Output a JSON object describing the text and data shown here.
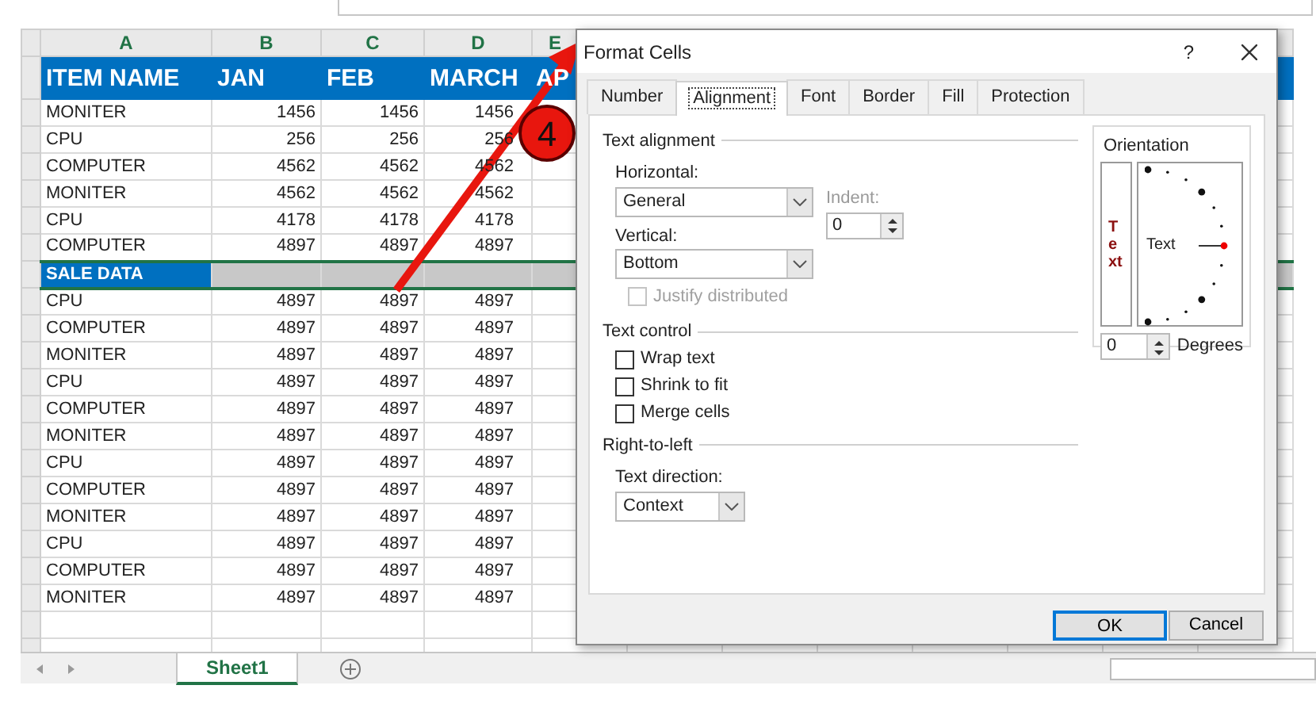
{
  "spreadsheet": {
    "column_letters": [
      "A",
      "B",
      "C",
      "D",
      "E"
    ],
    "header_row": [
      "ITEM NAME",
      "JAN",
      "FEB",
      "MARCH",
      "AP"
    ],
    "rows": [
      {
        "cells": [
          "MONITER",
          "1456",
          "1456",
          "1456"
        ],
        "selected": false
      },
      {
        "cells": [
          "CPU",
          "256",
          "256",
          "256"
        ],
        "selected": false
      },
      {
        "cells": [
          "COMPUTER",
          "4562",
          "4562",
          "4562"
        ],
        "selected": false
      },
      {
        "cells": [
          "MONITER",
          "4562",
          "4562",
          "4562"
        ],
        "selected": false
      },
      {
        "cells": [
          "CPU",
          "4178",
          "4178",
          "4178"
        ],
        "selected": false
      },
      {
        "cells": [
          "COMPUTER",
          "4897",
          "4897",
          "4897"
        ],
        "selected": false
      },
      {
        "cells": [
          "SALE DATA"
        ],
        "selected": true
      },
      {
        "cells": [
          "CPU",
          "4897",
          "4897",
          "4897"
        ],
        "selected": false
      },
      {
        "cells": [
          "COMPUTER",
          "4897",
          "4897",
          "4897"
        ],
        "selected": false
      },
      {
        "cells": [
          "MONITER",
          "4897",
          "4897",
          "4897"
        ],
        "selected": false
      },
      {
        "cells": [
          "CPU",
          "4897",
          "4897",
          "4897"
        ],
        "selected": false
      },
      {
        "cells": [
          "COMPUTER",
          "4897",
          "4897",
          "4897"
        ],
        "selected": false
      },
      {
        "cells": [
          "MONITER",
          "4897",
          "4897",
          "4897"
        ],
        "selected": false
      },
      {
        "cells": [
          "CPU",
          "4897",
          "4897",
          "4897"
        ],
        "selected": false
      },
      {
        "cells": [
          "COMPUTER",
          "4897",
          "4897",
          "4897"
        ],
        "selected": false
      },
      {
        "cells": [
          "MONITER",
          "4897",
          "4897",
          "4897"
        ],
        "selected": false
      },
      {
        "cells": [
          "CPU",
          "4897",
          "4897",
          "4897"
        ],
        "selected": false
      },
      {
        "cells": [
          "COMPUTER",
          "4897",
          "4897",
          "4897"
        ],
        "selected": false
      },
      {
        "cells": [
          "MONITER",
          "4897",
          "4897",
          "4897"
        ],
        "selected": false
      },
      {
        "cells": [],
        "selected": false
      },
      {
        "cells": [],
        "selected": false
      }
    ]
  },
  "sheet_tabs": [
    {
      "label": "Sheet1",
      "selected": true
    }
  ],
  "annotation": {
    "label": "4"
  },
  "dialog": {
    "title": "Format Cells",
    "help": "?",
    "tabs": [
      {
        "label": "Number",
        "selected": false
      },
      {
        "label": "Alignment",
        "selected": true
      },
      {
        "label": "Font",
        "selected": false
      },
      {
        "label": "Border",
        "selected": false
      },
      {
        "label": "Fill",
        "selected": false
      },
      {
        "label": "Protection",
        "selected": false
      }
    ],
    "text_alignment": {
      "title": "Text alignment",
      "horizontal": {
        "label": "Horizontal:",
        "value": "General"
      },
      "vertical": {
        "label": "Vertical:",
        "value": "Bottom"
      },
      "indent": {
        "label": "Indent:",
        "value": "0",
        "disabled": true
      },
      "justify": {
        "label": "Justify distributed",
        "checked": false,
        "disabled": true
      }
    },
    "text_control": {
      "title": "Text control",
      "options": [
        {
          "label": "Wrap text",
          "checked": false
        },
        {
          "label": "Shrink to fit",
          "checked": false
        },
        {
          "label": "Merge cells",
          "checked": false
        }
      ]
    },
    "right_to_left": {
      "title": "Right-to-left",
      "direction": {
        "label": "Text direction:",
        "value": "Context"
      }
    },
    "orientation": {
      "title": "Orientation",
      "vertical_text": "Text",
      "dial_text": "Text",
      "degrees": {
        "value": "0",
        "label": "Degrees"
      }
    },
    "buttons": [
      {
        "label": "OK",
        "default": true
      },
      {
        "label": "Cancel",
        "default": false
      }
    ]
  }
}
